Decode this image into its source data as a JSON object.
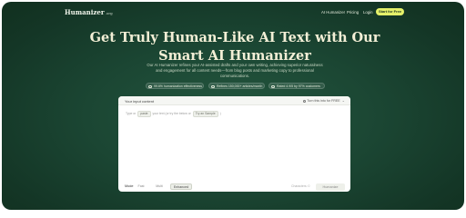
{
  "nav": {
    "logo": "Humanizer",
    "logo_suffix": ".org",
    "links": [
      "AI Humanizer",
      "Pricing",
      "Login"
    ],
    "cta": "Start for Free"
  },
  "hero": {
    "title_line1": "Get Truly Human-Like AI Text with Our",
    "title_line2": "Smart AI Humanizer",
    "subtitle": "Our AI Humanizer refines your AI-assisted drafts and your own writing, achieving superior naturalness and engagement for all content needs—from blog posts and marketing copy to professional communications."
  },
  "badges": [
    "99.6% humanization effectiveness",
    "Refines 150,000+ articles/month",
    "Rated 4.9/5 by 97% customers"
  ],
  "editor": {
    "title": "Your input content",
    "mode_select": "Turn this into for FREE",
    "hint_prefix": "Type or",
    "hint_paste": "paste",
    "hint_middle": "your text (or try the below or",
    "hint_try": "Try an Sample",
    "hint_suffix": ")",
    "mode_label": "Mode",
    "modes": [
      "Fast",
      "Multi",
      "Enhanced"
    ],
    "active_mode": "Enhanced",
    "char_count": "Characters: 0",
    "submit": "Humanize"
  },
  "colors": {
    "background": "#1b4633",
    "cta": "#e4f06a",
    "title": "#f3efd6"
  }
}
